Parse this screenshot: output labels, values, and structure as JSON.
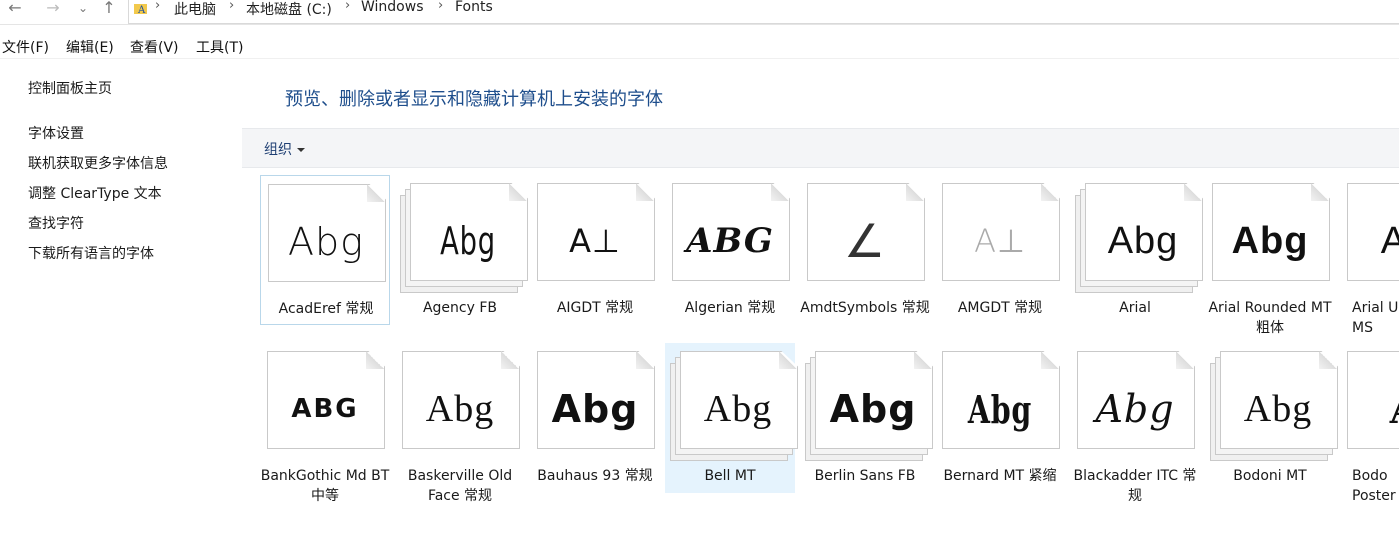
{
  "address": {
    "back_icon": "←",
    "forward_icon": "→",
    "down_icon": "⌄",
    "up_icon": "↑",
    "sep": "›",
    "crumbs": [
      "此电脑",
      "本地磁盘 (C:)",
      "Windows",
      "Fonts"
    ]
  },
  "menu": {
    "items": [
      "文件(F)",
      "编辑(E)",
      "查看(V)",
      "工具(T)"
    ]
  },
  "left_pane": {
    "links": [
      "控制面板主页",
      "字体设置",
      "联机获取更多字体信息",
      "调整 ClearType 文本",
      "查找字符",
      "下载所有语言的字体"
    ]
  },
  "main": {
    "title": "预览、删除或者显示和隐藏计算机上安装的字体",
    "organize_label": "组织"
  },
  "fonts": [
    {
      "sample": "Abg",
      "label": "AcadEref 常规",
      "stack": false
    },
    {
      "sample": "Abg",
      "label": "Agency FB",
      "stack": true
    },
    {
      "sample": "A⊥",
      "label": "AIGDT 常规",
      "stack": false
    },
    {
      "sample": "ABG",
      "label": "Algerian 常规",
      "stack": false
    },
    {
      "sample": "∠",
      "label": "AmdtSymbols 常规",
      "stack": false
    },
    {
      "sample": "A⊥",
      "label": "AMGDT 常规",
      "stack": false
    },
    {
      "sample": "Abg",
      "label": "Arial",
      "stack": true
    },
    {
      "sample": "Abg",
      "label": "Arial Rounded MT 粗体",
      "stack": false
    },
    {
      "sample": "Ab",
      "label": "Arial U MS",
      "stack": false
    },
    {
      "sample": "ABG",
      "label": "BankGothic Md BT 中等",
      "stack": false
    },
    {
      "sample": "Abg",
      "label": "Baskerville Old Face 常规",
      "stack": false
    },
    {
      "sample": "Abg",
      "label": "Bauhaus 93 常规",
      "stack": false
    },
    {
      "sample": "Abg",
      "label": "Bell MT",
      "stack": true
    },
    {
      "sample": "Abg",
      "label": "Berlin Sans FB",
      "stack": true
    },
    {
      "sample": "Abg",
      "label": "Bernard MT 紧缩",
      "stack": false
    },
    {
      "sample": "Abg",
      "label": "Blackadder ITC 常规",
      "stack": false
    },
    {
      "sample": "Abg",
      "label": "Bodoni MT",
      "stack": true
    },
    {
      "sample": "A",
      "label": "Bodo Poster",
      "stack": false
    }
  ]
}
